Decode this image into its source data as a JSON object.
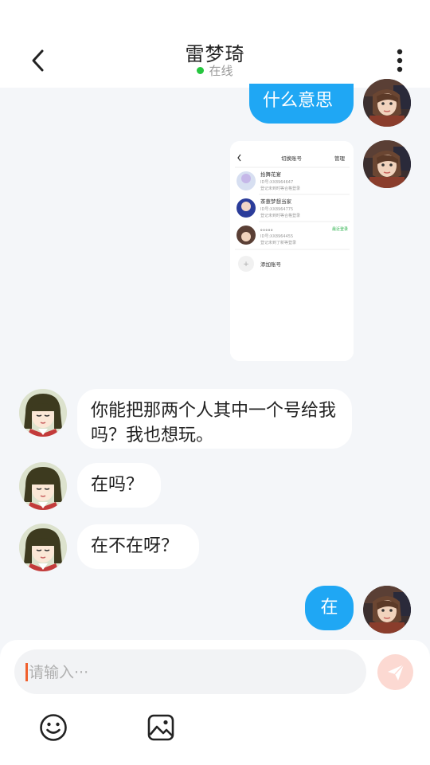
{
  "header": {
    "title": "雷梦琦",
    "status": "在线",
    "status_color": "#26c63f"
  },
  "messages": [
    {
      "from": "me",
      "type": "text",
      "text": "什么意思"
    },
    {
      "from": "me",
      "type": "image",
      "image": {
        "title": "切换账号",
        "action": "管理",
        "accounts": [
          {
            "name": "拾舞花宴",
            "line1": "ID号:XX8964647",
            "line2": "登记未到时等合格登录"
          },
          {
            "name": "茶薏梦想当家",
            "line1": "ID号:XX8964775",
            "line2": "登记未到时等合格登录"
          },
          {
            "name": "。。。。。",
            "line1": "ID号:XX8964455",
            "line2": "登记未到了新等登录",
            "tag": "最近登录"
          }
        ],
        "add_label": "添加账号"
      }
    },
    {
      "from": "them",
      "type": "text",
      "text": "你能把那两个人其中一个号给我吗？我也想玩。"
    },
    {
      "from": "them",
      "type": "text",
      "text": "在吗？"
    },
    {
      "from": "them",
      "type": "text",
      "text": "在不在呀？"
    },
    {
      "from": "me",
      "type": "text",
      "text": "在"
    }
  ],
  "composer": {
    "placeholder": "请输入···",
    "send_icon": "send-icon",
    "tools": [
      "emoji-icon",
      "image-icon"
    ]
  },
  "colors": {
    "my_bubble": "#1fa7f4",
    "their_bubble": "#ffffff",
    "background": "#f4f6f9",
    "send_button": "#fcd9d2",
    "caret": "#f0602d"
  }
}
